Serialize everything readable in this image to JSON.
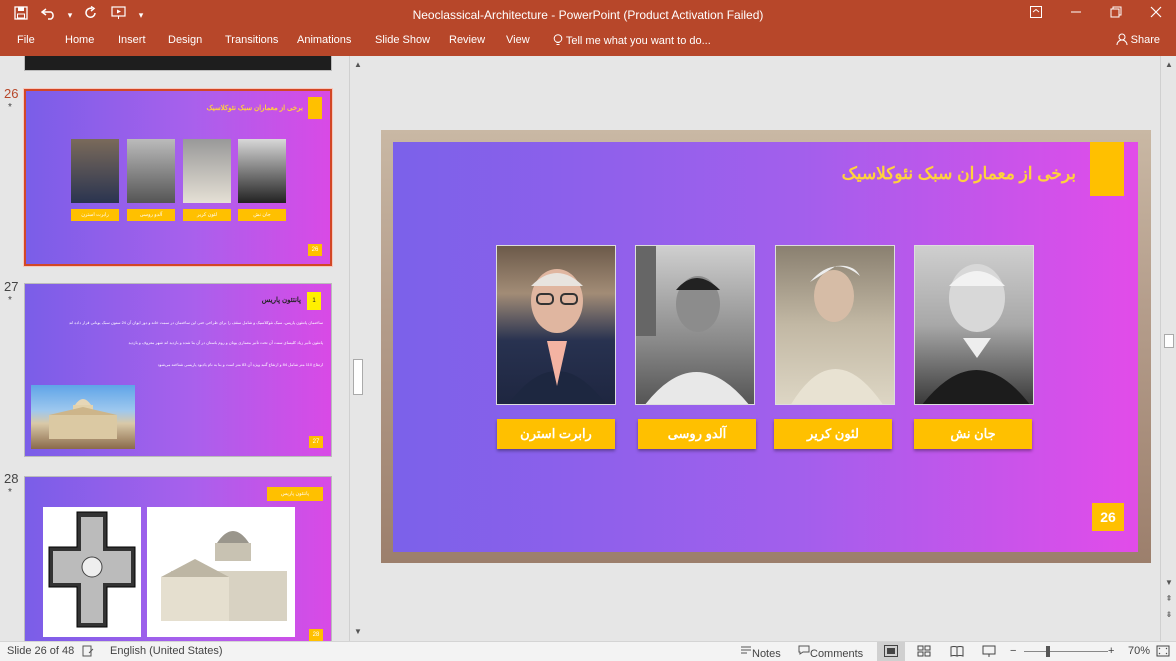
{
  "window": {
    "title": "Neoclassical-Architecture - PowerPoint (Product Activation Failed)",
    "controls": [
      "▭",
      "—",
      "❐",
      "✕"
    ]
  },
  "qat": {
    "save_icon": "💾",
    "undo_icon": "↶",
    "redo_icon": "↻",
    "present_icon": "▶",
    "more_icon": "▾"
  },
  "ribbon": {
    "tabs": [
      "File",
      "Home",
      "Insert",
      "Design",
      "Transitions",
      "Animations",
      "Slide Show",
      "Review",
      "View"
    ],
    "tell_me": "Tell me what you want to do...",
    "share": "Share"
  },
  "thumbnails": [
    {
      "number": "26",
      "star": "*",
      "title": "برخی از معماران سبک نئوکلاسیک",
      "names": [
        "رابرت استرن",
        "آلدو روسی",
        "لئون کریر",
        "جان نش"
      ],
      "page": "26"
    },
    {
      "number": "27",
      "star": "*",
      "title": "پانتئون پاریس",
      "page": "27",
      "box": "1",
      "lines": [
        "ساختمان پانتئون پاریس، سبک نئوکلاسیک و شامل سقف را برای طراحی حتی این ساختمان در سمت خانه و دور ایوان آن 24 ستون سبک یونانی قرار داده اند",
        "پانتئون تأثیر زیاد کلیسای‌ سنت آن تحت تأثیر معماری یونان و روم باستان در آن بنا شده و بازدید اند شهر معروف و بازدید",
        "ارتفاع 110 متر شامل 84 و ارتفاع گنبد ویژه آن 83 متر است و بنا به نام یادبود پاریسی شناخته می‌شود"
      ]
    },
    {
      "number": "28",
      "star": "*",
      "title": "پانتئون پاریس",
      "page": "28"
    }
  ],
  "slide": {
    "title": "برخی از معماران سبک نئوکلاسیک",
    "architects": [
      {
        "name": "رابرت استرن"
      },
      {
        "name": "آلدو روسی"
      },
      {
        "name": "لئون کریر"
      },
      {
        "name": "جان نش"
      }
    ],
    "page_number": "26"
  },
  "status": {
    "slide_info": "Slide 26 of 48",
    "language": "English (United States)",
    "notes": "Notes",
    "comments": "Comments",
    "zoom": "70%"
  }
}
